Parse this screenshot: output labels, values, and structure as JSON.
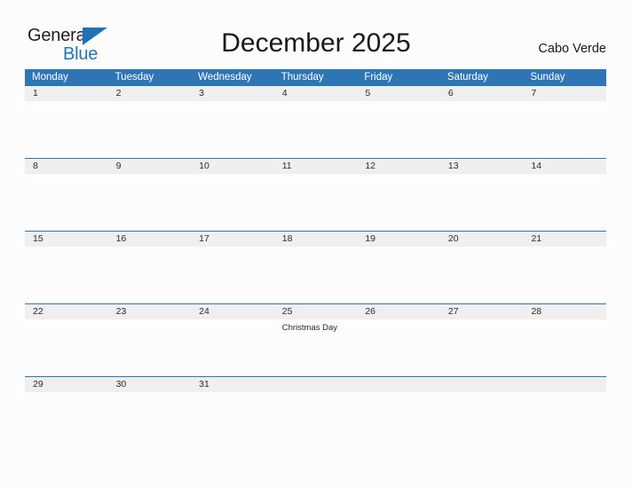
{
  "brand": {
    "name_part1": "General",
    "name_part2": "Blue",
    "flag_icon": "flag-triangle-icon",
    "blue_color": "#2272bb",
    "dark_color": "#231f20"
  },
  "header": {
    "title": "December 2025",
    "region": "Cabo Verde"
  },
  "calendar": {
    "header_bg_color": "#2e75b6",
    "date_band_color": "#efefef",
    "weekdays": [
      "Monday",
      "Tuesday",
      "Wednesday",
      "Thursday",
      "Friday",
      "Saturday",
      "Sunday"
    ],
    "weeks": [
      {
        "days": [
          {
            "num": "1",
            "event": ""
          },
          {
            "num": "2",
            "event": ""
          },
          {
            "num": "3",
            "event": ""
          },
          {
            "num": "4",
            "event": ""
          },
          {
            "num": "5",
            "event": ""
          },
          {
            "num": "6",
            "event": ""
          },
          {
            "num": "7",
            "event": ""
          }
        ]
      },
      {
        "days": [
          {
            "num": "8",
            "event": ""
          },
          {
            "num": "9",
            "event": ""
          },
          {
            "num": "10",
            "event": ""
          },
          {
            "num": "11",
            "event": ""
          },
          {
            "num": "12",
            "event": ""
          },
          {
            "num": "13",
            "event": ""
          },
          {
            "num": "14",
            "event": ""
          }
        ]
      },
      {
        "days": [
          {
            "num": "15",
            "event": ""
          },
          {
            "num": "16",
            "event": ""
          },
          {
            "num": "17",
            "event": ""
          },
          {
            "num": "18",
            "event": ""
          },
          {
            "num": "19",
            "event": ""
          },
          {
            "num": "20",
            "event": ""
          },
          {
            "num": "21",
            "event": ""
          }
        ]
      },
      {
        "days": [
          {
            "num": "22",
            "event": ""
          },
          {
            "num": "23",
            "event": ""
          },
          {
            "num": "24",
            "event": ""
          },
          {
            "num": "25",
            "event": "Christmas Day"
          },
          {
            "num": "26",
            "event": ""
          },
          {
            "num": "27",
            "event": ""
          },
          {
            "num": "28",
            "event": ""
          }
        ]
      },
      {
        "days": [
          {
            "num": "29",
            "event": ""
          },
          {
            "num": "30",
            "event": ""
          },
          {
            "num": "31",
            "event": ""
          },
          {
            "num": "",
            "event": ""
          },
          {
            "num": "",
            "event": ""
          },
          {
            "num": "",
            "event": ""
          },
          {
            "num": "",
            "event": ""
          }
        ]
      }
    ]
  }
}
